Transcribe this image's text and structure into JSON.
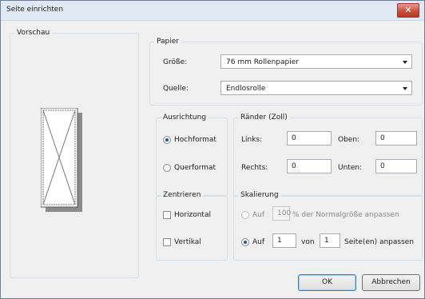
{
  "window": {
    "title": "Seite einrichten",
    "close_symbol": "✕"
  },
  "preview": {
    "label": "Vorschau"
  },
  "paper": {
    "group_label": "Papier",
    "size_label": "Größe:",
    "size_value": "76 mm Rollenpapier",
    "source_label": "Quelle:",
    "source_value": "Endlosrolle"
  },
  "orientation": {
    "group_label": "Ausrichtung",
    "portrait": "Hochformat",
    "landscape": "Querformat",
    "selected": "portrait"
  },
  "margins": {
    "group_label": "Ränder (Zoll)",
    "left_label": "Links:",
    "left_value": "0",
    "top_label": "Oben:",
    "top_value": "0",
    "right_label": "Rechts:",
    "right_value": "0",
    "bottom_label": "Unten:",
    "bottom_value": "0"
  },
  "center": {
    "group_label": "Zentrieren",
    "horizontal": "Horizontal",
    "vertical": "Vertikal"
  },
  "scaling": {
    "group_label": "Skalierung",
    "percent_radio_label": "Auf",
    "percent_value": "100",
    "percent_suffix": "% der Normalgröße anpassen",
    "fit_radio_label": "Auf",
    "fit_wide_value": "1",
    "fit_of_label": "von",
    "fit_tall_value": "1",
    "fit_suffix": "Seite(en) anpassen"
  },
  "buttons": {
    "ok": "OK",
    "cancel": "Abbrechen"
  }
}
